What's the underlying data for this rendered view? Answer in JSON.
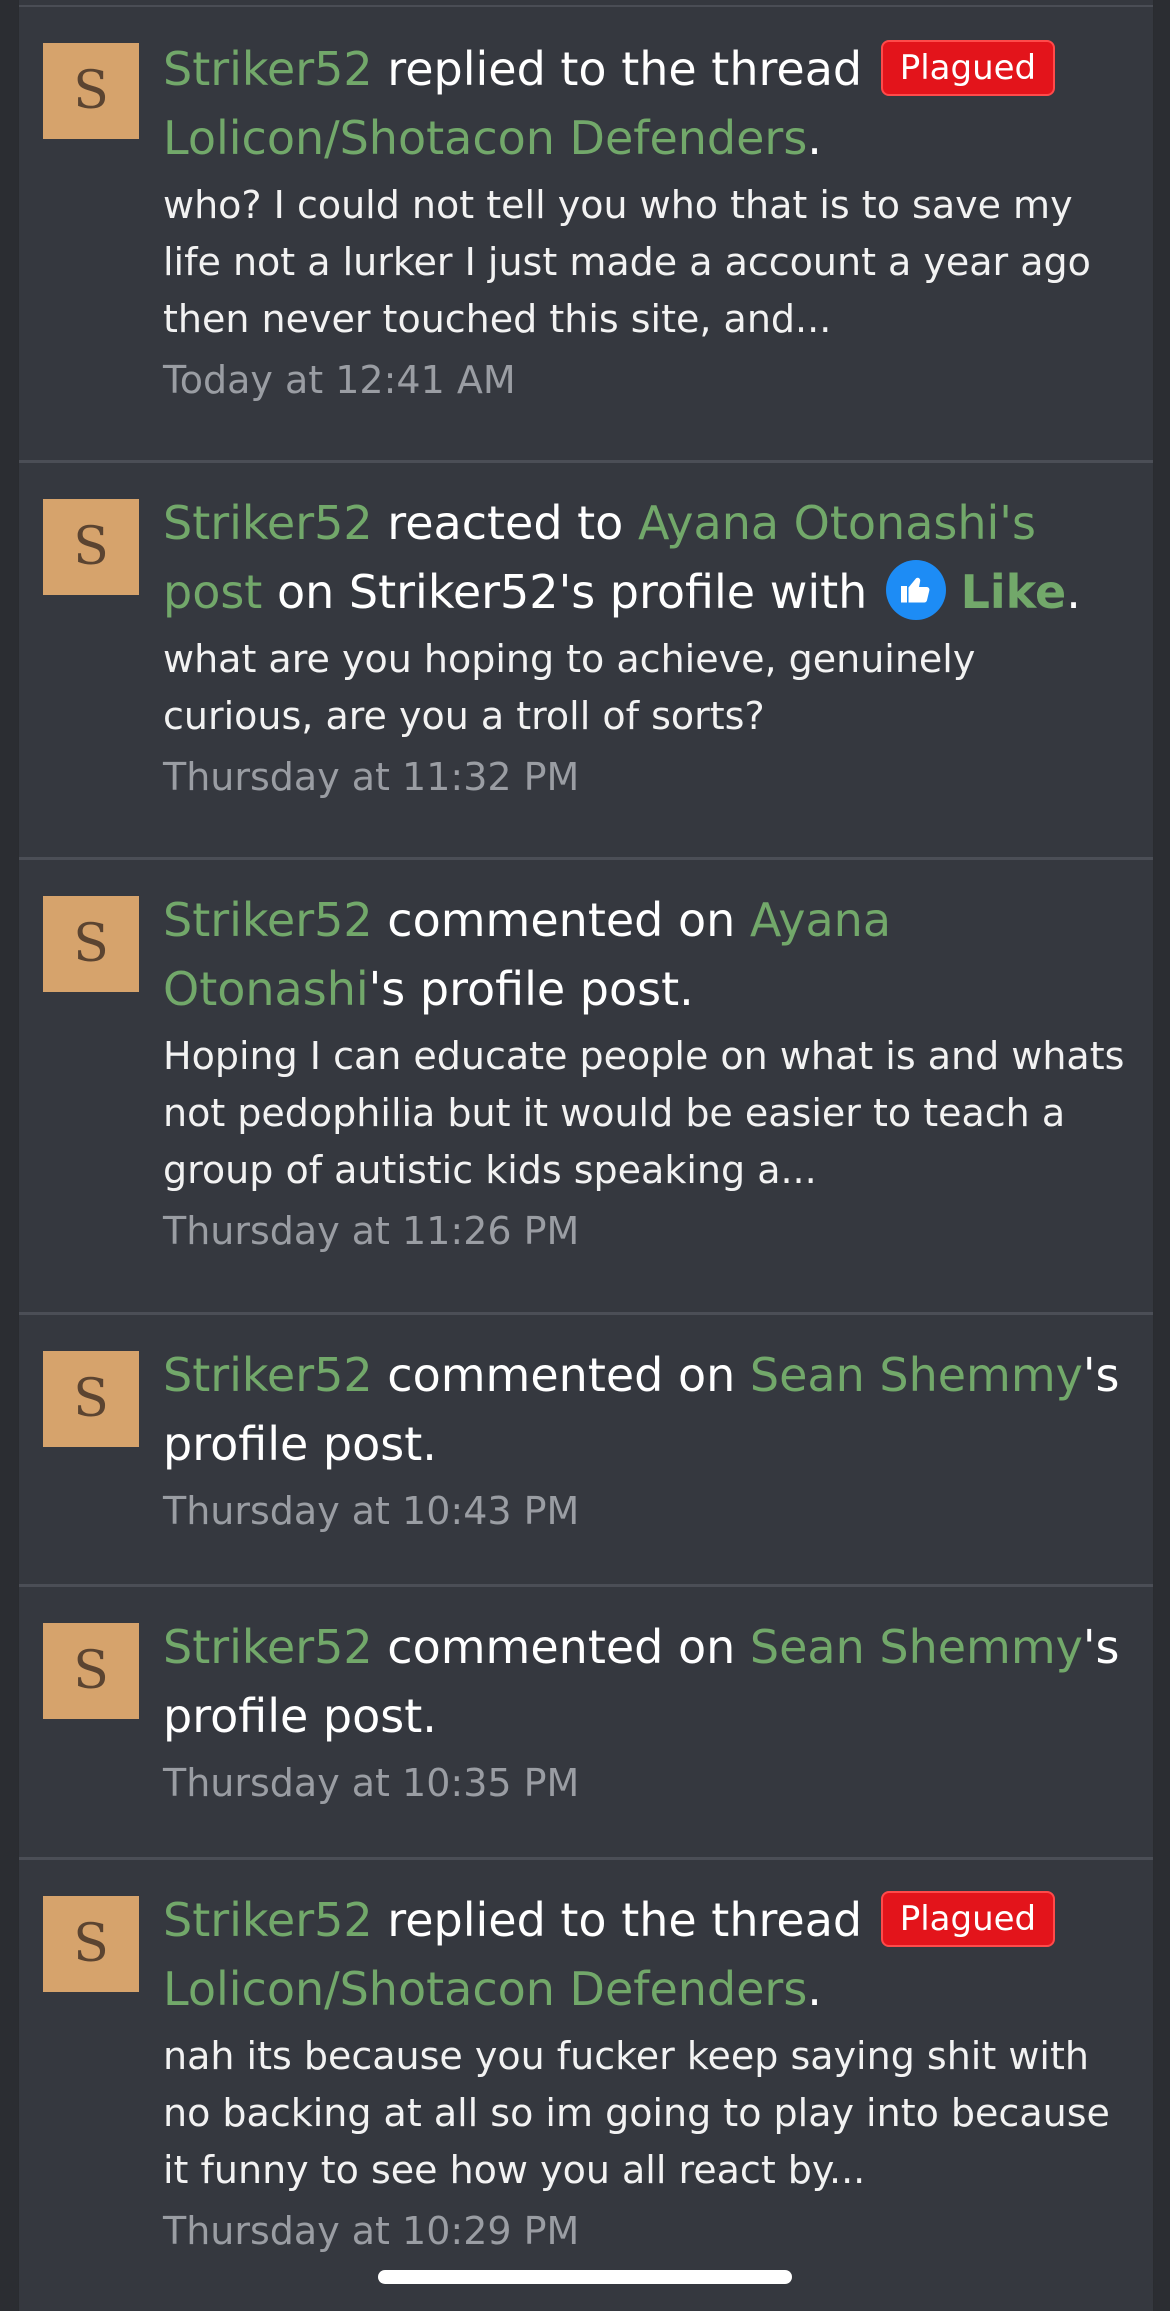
{
  "avatar_letter": "S",
  "items": [
    {
      "user": "Striker52",
      "action": " replied to the thread ",
      "badge": "Plagued",
      "target": "Lolicon/Shotacon Defenders",
      "suffix": ".",
      "snippet": "who? I could not tell you who that is to save my life not a lurker I just made a account a year ago then never touched this site, and...",
      "time": "Today at 12:41 AM"
    },
    {
      "user": "Striker52",
      "action": " reacted to ",
      "target": "Ayana Otonashi's post",
      "middle": " on Striker52's profile with ",
      "reaction": "Like",
      "suffix": ".",
      "snippet": "what are you hoping to achieve, genuinely curious, are you a troll of sorts?",
      "time": "Thursday at 11:32 PM",
      "icon": "thumbs-up-icon"
    },
    {
      "user": "Striker52",
      "action": " commented on ",
      "target": "Ayana Otonashi",
      "suffix": "'s profile post.",
      "snippet": "Hoping I can educate people on what is and whats not pedophilia but it would be easier to teach a group of autistic kids speaking a...",
      "time": "Thursday at 11:26 PM"
    },
    {
      "user": "Striker52",
      "action": " commented on ",
      "target": "Sean Shemmy",
      "suffix": "'s profile post.",
      "time": "Thursday at 10:43 PM"
    },
    {
      "user": "Striker52",
      "action": " commented on ",
      "target": "Sean Shemmy",
      "suffix": "'s profile post.",
      "time": "Thursday at 10:35 PM"
    },
    {
      "user": "Striker52",
      "action": " replied to the thread ",
      "badge": "Plagued",
      "target": "Lolicon/Shotacon Defenders",
      "suffix": ".",
      "snippet": "nah its because you fucker keep saying shit with no backing at all so im going to play into because it funny to see how you all react by...",
      "time": "Thursday at 10:29 PM"
    }
  ],
  "colors": {
    "background": "#35383f",
    "link": "#72a86a",
    "badge": "#e3141b",
    "avatar": "#d6a36c",
    "timestamp": "#9a9da3",
    "like_icon": "#1d8cf5"
  }
}
